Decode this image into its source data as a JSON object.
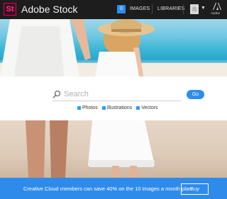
{
  "header": {
    "logo_text": "St",
    "app_title": "Adobe Stock",
    "images_count": "0",
    "images_label": "IMAGES",
    "libraries_label": "LIBRARIES",
    "adobe_label": "Adobe"
  },
  "search": {
    "placeholder": "Search",
    "go_label": "Go",
    "filters": [
      {
        "label": "Photos"
      },
      {
        "label": "Illustrations"
      },
      {
        "label": "Vectors"
      }
    ]
  },
  "promo": {
    "text": "Creative Cloud members can save 40% on the 10 images a month plan",
    "buy_label": "Buy"
  },
  "colors": {
    "header_bg": "#1d1d1d",
    "accent": "#2d8cf0",
    "logo_pink": "#e0005a",
    "promo_bg": "#2e8bea"
  },
  "icons": [
    "stock-logo-icon",
    "avatar-icon",
    "chevron-down-icon",
    "adobe-logo-icon",
    "search-icon"
  ]
}
